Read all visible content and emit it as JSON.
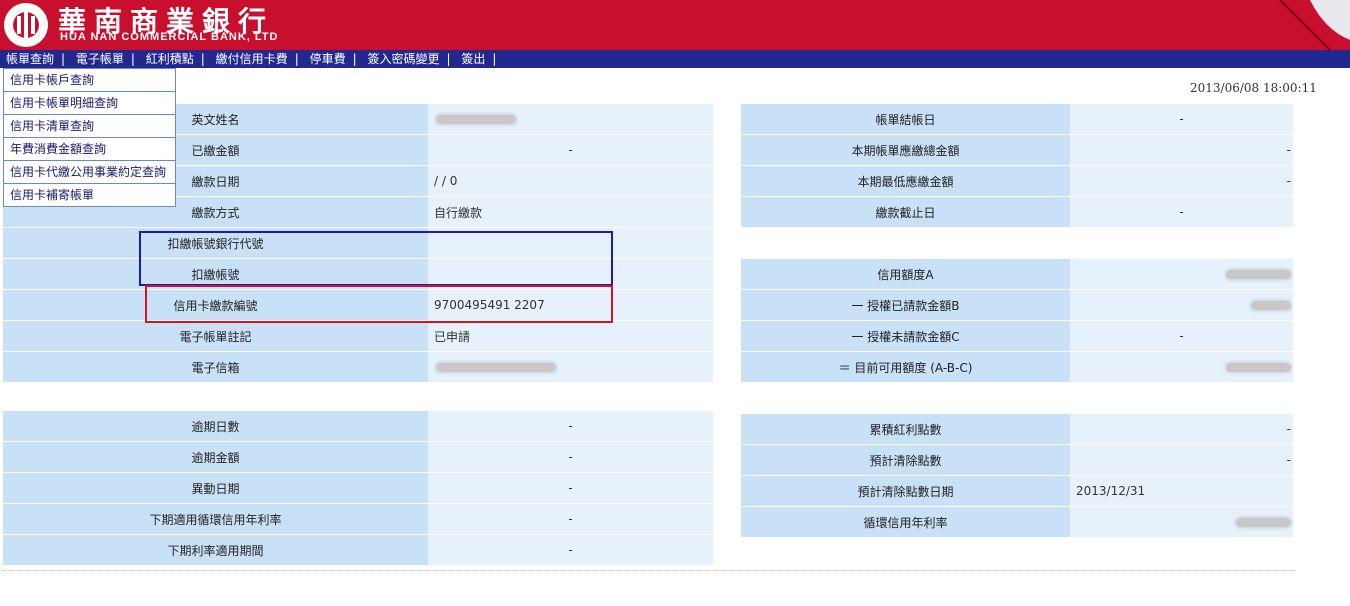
{
  "header": {
    "bank_name_zh": "華南商業銀行",
    "bank_name_en": "HUA NAN COMMERCIAL BANK, LTD",
    "brand_color": "#c8102e",
    "nav_color": "#23288f"
  },
  "menu": [
    "帳單查詢",
    "電子帳單",
    "紅利積點",
    "繳付信用卡費",
    "停車費",
    "簽入密碼變更",
    "簽出"
  ],
  "dropdown": [
    "信用卡帳戶查詢",
    "信用卡帳單明細查詢",
    "信用卡清單查詢",
    "年費消費金額查詢",
    "信用卡代繳公用事業約定查詢",
    "信用卡補寄帳單"
  ],
  "datetime": "2013/06/08 18:00:11",
  "left_top": [
    {
      "label": "英文姓名",
      "value": ""
    },
    {
      "label": "已繳金額",
      "value": "-"
    },
    {
      "label": "繳款日期",
      "value": "/ / 0"
    },
    {
      "label": "繳款方式",
      "value": "自行繳款"
    },
    {
      "label": "扣繳帳號銀行代號",
      "value": ""
    },
    {
      "label": "扣繳帳號",
      "value": ""
    },
    {
      "label": "信用卡繳款編號",
      "value": "9700495491 2207"
    },
    {
      "label": "電子帳單註記",
      "value": "已申請"
    },
    {
      "label": "電子信箱",
      "value": ""
    }
  ],
  "right_top": [
    {
      "label": "帳單結帳日",
      "value": "-"
    },
    {
      "label": "本期帳單應繳總金額",
      "value": "-"
    },
    {
      "label": "本期最低應繳金額",
      "value": "-"
    },
    {
      "label": "繳款截止日",
      "value": "-"
    }
  ],
  "right_mid": [
    {
      "label": "信用額度A",
      "value": ""
    },
    {
      "label": "一 授權已請款金額B",
      "value": ""
    },
    {
      "label": "一 授權未請款金額C",
      "value": "-"
    },
    {
      "label": "＝ 目前可用額度 (A-B-C)",
      "value": ""
    }
  ],
  "left_bottom": [
    {
      "label": "逾期日數",
      "value": "-"
    },
    {
      "label": "逾期金額",
      "value": "-"
    },
    {
      "label": "異動日期",
      "value": "-"
    },
    {
      "label": "下期適用循環信用年利率",
      "value": "-"
    },
    {
      "label": "下期利率適用期間",
      "value": "-"
    }
  ],
  "right_bottom": [
    {
      "label": "累積紅利點數",
      "value": "-"
    },
    {
      "label": "預計清除點數",
      "value": "-"
    },
    {
      "label": "預計清除點數日期",
      "value": "2013/12/31"
    },
    {
      "label": "循環信用年利率",
      "value": ""
    }
  ]
}
